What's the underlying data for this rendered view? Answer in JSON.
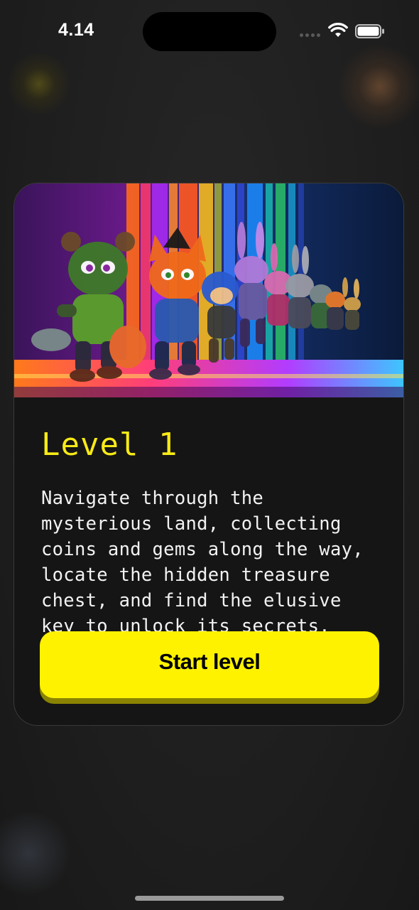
{
  "status_bar": {
    "time": "4.14",
    "wifi_icon": "wifi-icon",
    "battery_icon": "battery-icon"
  },
  "level_card": {
    "image_icon": "level-hero-image",
    "title": "Level 1",
    "description": "Navigate through the mysterious land, collecting coins and gems along the way, locate the hidden treasure chest, and find the elusive key to unlock its secrets.",
    "start_button_label": "Start level"
  },
  "colors": {
    "accent": "#fef201",
    "title": "#f7ea16",
    "card_bg": "#151515",
    "page_bg": "#1c1c1c"
  }
}
